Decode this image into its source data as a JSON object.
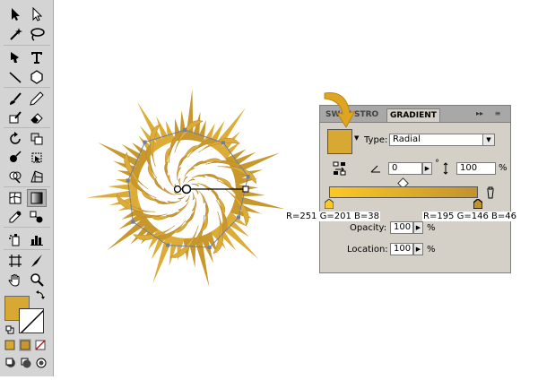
{
  "gradient_panel": {
    "tab_1": "SWAT",
    "tab_2": "STRO",
    "tab_3": "GRADIENT",
    "collapse_glyph": "▸▸",
    "menu_glyph": "≡",
    "type_label": "Type:",
    "type_value": "Radial",
    "angle_value": "0",
    "degree_symbol": "°",
    "aspect_value": "100",
    "percent_symbol": "%",
    "opacity_label": "Opacity:",
    "opacity_value": "100",
    "location_label": "Location:",
    "location_value": "100",
    "dropdown_glyph": "▼",
    "spin_glyph": "▶"
  },
  "readouts": {
    "left_stop": "R=251 G=201 B=38",
    "right_stop": "R=195 G=146 B=46"
  },
  "colors": {
    "fill": "#d7a932",
    "gradient_start": "#fbc926",
    "gradient_end": "#c3922e",
    "shape": "#dcac36",
    "shape_dark": "#c8982c",
    "arrow": "#e0a520"
  },
  "icons": [
    "selection-icon",
    "direct-selection-icon",
    "magic-wand-icon",
    "lasso-icon",
    "pen-icon",
    "type-icon",
    "line-segment-icon",
    "polygon-icon",
    "paintbrush-icon",
    "pencil-icon",
    "blob-brush-icon",
    "eraser-icon",
    "rotate-icon",
    "scale-icon",
    "warp-icon",
    "free-transform-icon",
    "shape-builder-icon",
    "perspective-grid-icon",
    "mesh-icon",
    "gradient-icon",
    "eyedropper-icon",
    "blend-icon",
    "symbol-sprayer-icon",
    "column-graph-icon",
    "artboard-icon",
    "slice-icon",
    "hand-icon",
    "zoom-icon"
  ]
}
